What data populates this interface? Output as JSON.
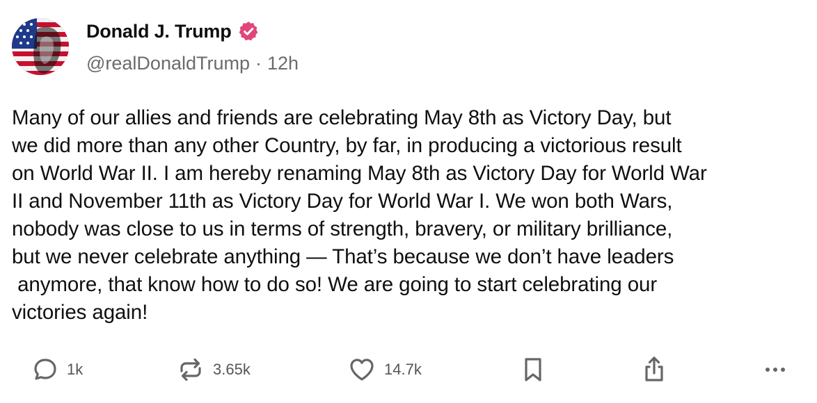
{
  "post": {
    "author": {
      "display_name": "Donald J. Trump",
      "verified": true,
      "handle": "@realDonaldTrump",
      "separator": "·",
      "time_ago": "12h",
      "verified_color": "#e0457b"
    },
    "body": "Many of our allies and friends are celebrating May 8th as Victory Day, but\nwe did more than any other Country, by far, in producing a victorious result\non World War II. I am hereby renaming May 8th as Victory Day for World War\nII and November 11th as Victory Day for World War I. We won both Wars,\nnobody was close to us in terms of strength, bravery, or military brilliance,\nbut we never celebrate anything — That’s because we don’t have leaders\n anymore, that know how to do so! We are going to start celebrating our\nvictories again!",
    "actions": {
      "reply": {
        "icon": "reply-icon",
        "count": "1k"
      },
      "repost": {
        "icon": "repost-icon",
        "count": "3.65k"
      },
      "like": {
        "icon": "heart-icon",
        "count": "14.7k"
      },
      "bookmark": {
        "icon": "bookmark-icon"
      },
      "share": {
        "icon": "share-icon"
      },
      "more": {
        "icon": "more-icon"
      }
    }
  }
}
